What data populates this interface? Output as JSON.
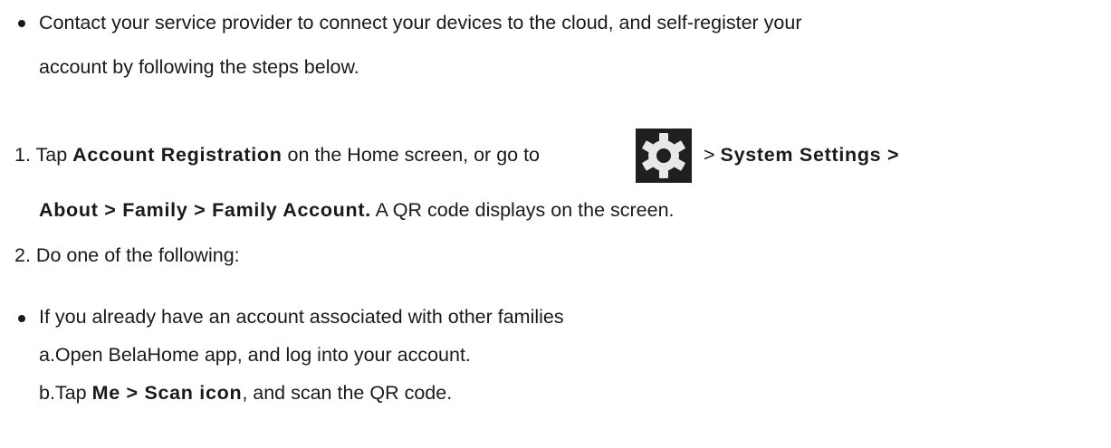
{
  "bullet1": {
    "line1": "Contact your service provider to connect your devices to the cloud, and self-register your",
    "line2": "account by following the steps below."
  },
  "step1": {
    "num": "1.",
    "pre": "Tap ",
    "bold1": "Account Registration",
    "mid": " on the Home screen, or go to ",
    "gt": ">",
    "bold2": "System Settings >",
    "line2_bold": "About > Family > Family Account.",
    "line2_rest": " A QR code displays on the screen.",
    "icon": "settings-gear-icon"
  },
  "step2": {
    "num": "2.",
    "text": "Do one of the following:"
  },
  "bullet2": {
    "line1": "If you already have an account associated with other families",
    "a": "a.Open BelaHome app, and log into your account.",
    "b_pre": "b.Tap ",
    "b_bold": "Me > Scan icon",
    "b_rest": ", and scan the QR code."
  }
}
